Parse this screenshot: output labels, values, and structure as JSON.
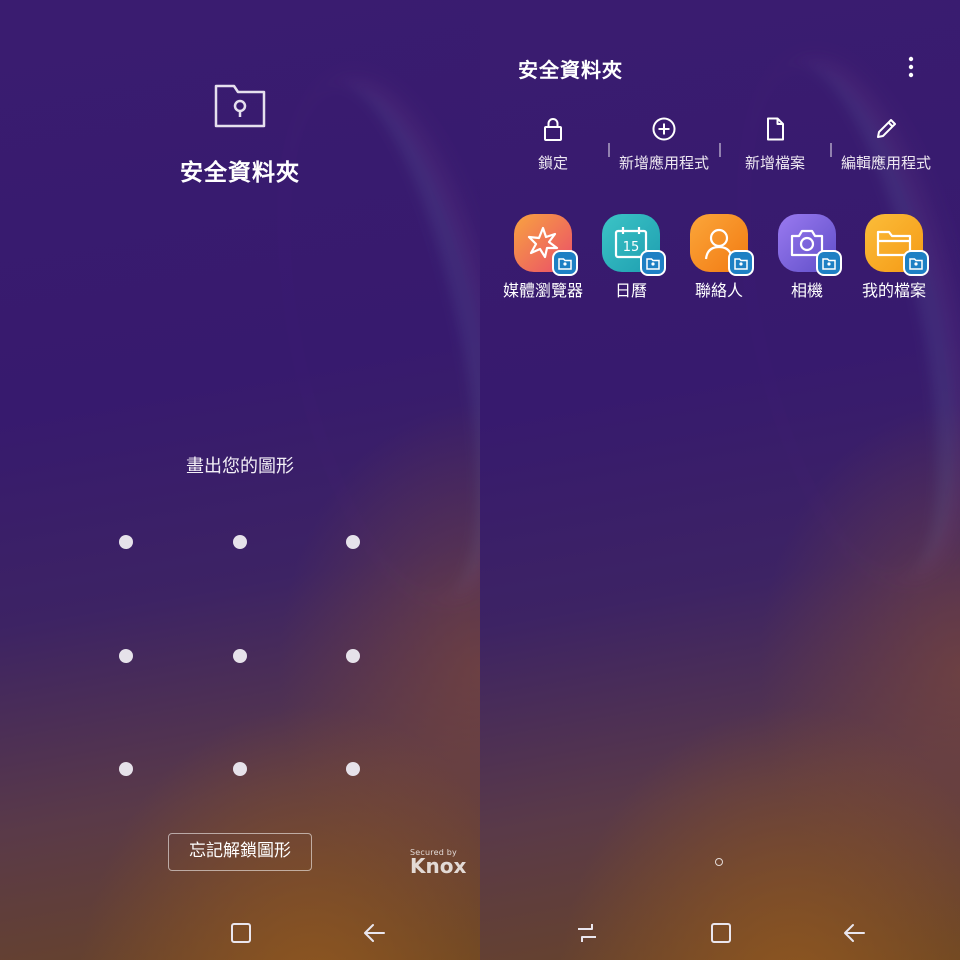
{
  "lock_screen": {
    "title": "安全資料夾",
    "prompt": "畫出您的圖形",
    "forgot_button_label": "忘記解鎖圖形",
    "knox_secured_by": "Secured by",
    "knox_brand": "Knox",
    "folder_icon": "secure-folder-icon",
    "nav": [
      "home-icon",
      "back-icon"
    ]
  },
  "home_screen": {
    "title": "安全資料夾",
    "more_icon": "more-vertical-icon",
    "toolbar": [
      {
        "label": "鎖定",
        "icon": "lock-icon"
      },
      {
        "label": "新增應用程式",
        "icon": "add-circle-icon"
      },
      {
        "label": "新增檔案",
        "icon": "file-icon"
      },
      {
        "label": "編輯應用程式",
        "icon": "pencil-icon"
      }
    ],
    "apps": [
      {
        "label": "媒體瀏覽器",
        "icon": "gallery-icon",
        "color": "#f07a3c"
      },
      {
        "label": "日曆",
        "icon": "calendar-icon",
        "color": "#2ab6b8"
      },
      {
        "label": "聯絡人",
        "icon": "contacts-icon",
        "color": "#f6921e"
      },
      {
        "label": "相機",
        "icon": "camera-icon",
        "color": "#7a62d8"
      },
      {
        "label": "我的檔案",
        "icon": "folder-icon",
        "color": "#f5a623"
      }
    ],
    "nav": [
      "recents-icon",
      "home-icon",
      "back-icon"
    ]
  }
}
